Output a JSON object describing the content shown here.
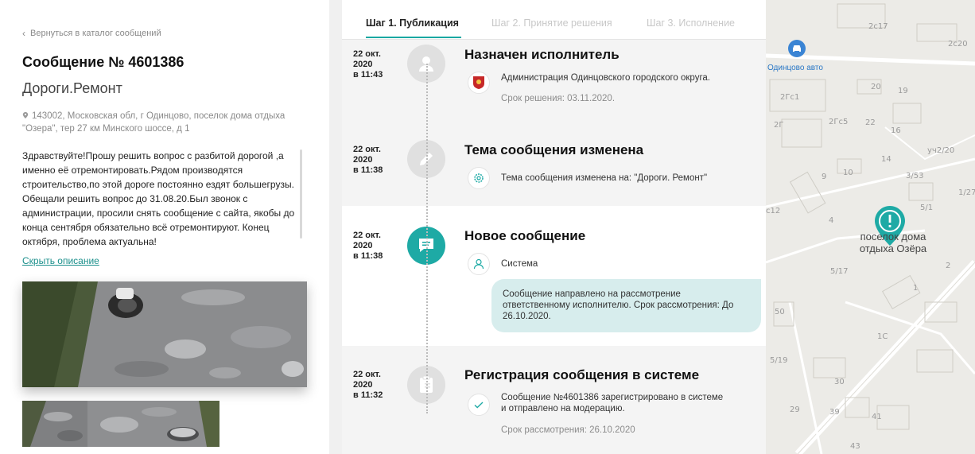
{
  "left": {
    "back_link": "Вернуться в каталог сообщений",
    "title": "Сообщение № 4601386",
    "category": "Дороги.Ремонт",
    "address": "143002, Московская обл, г Одинцово, поселок дома отдыха \"Озера\", тер 27 км Минского шоссе, д 1",
    "description": "Здравствуйте!Прошу решить вопрос с разбитой дорогой ,а именно её отремонтировать.Рядом производятся строительство,по этой дороге постоянно ездят большегрузы. Обещали решить вопрос до 31.08.20.Был звонок с администрации, просили снять сообщение с сайта, якобы до конца сентября обязательно всё отремонтируют. Конец октября, проблема актуальна!",
    "hide_description": "Скрыть описание"
  },
  "tabs": [
    {
      "label": "Шаг 1. Публикация",
      "active": true
    },
    {
      "label": "Шаг 2. Принятие решения",
      "active": false
    },
    {
      "label": "Шаг 3. Исполнение",
      "active": false
    }
  ],
  "events": [
    {
      "date": "22 окт.",
      "year": "2020",
      "time": "в 11:43",
      "title": "Назначен исполнитель",
      "icon": "person-icon",
      "text": "Администрация Одинцовского городского округа.",
      "sub": "Срок решения: 03.11.2020."
    },
    {
      "date": "22 окт.",
      "year": "2020",
      "time": "в 11:38",
      "title": "Тема сообщения изменена",
      "icon": "pencil-icon",
      "text": "Тема сообщения изменена на: \"Дороги. Ремонт\""
    },
    {
      "date": "22 окт.",
      "year": "2020",
      "time": "в 11:38",
      "title": "Новое сообщение",
      "icon": "message-icon",
      "text": "Система",
      "bubble": "Сообщение направлено на рассмотрение ответственному исполнителю. Срок рассмотрения: До 26.10.2020."
    },
    {
      "date": "22 окт.",
      "year": "2020",
      "time": "в 11:32",
      "title": "Регистрация сообщения в системе",
      "icon": "clipboard-icon",
      "text_line1": "Сообщение №4601386 зарегистрировано в системе",
      "text_line2": "и отправлено на модерацию.",
      "sub": "Срок рассмотрения: 26.10.2020"
    }
  ],
  "map": {
    "poi": "Одинцово авто",
    "place_line1": "поселок дома",
    "place_line2": "отдыха Озёра",
    "labels": [
      "2с17",
      "2с20",
      "20",
      "19",
      "2Гс1",
      "2Гс5",
      "22",
      "2Г",
      "16",
      "уч2/20",
      "14",
      "3/53",
      "9",
      "10",
      "1/27",
      "5/1",
      "с12",
      "4",
      "2",
      "5/17",
      "1",
      "50",
      "1С",
      "5/19",
      "30",
      "29",
      "39",
      "41",
      "43"
    ]
  },
  "colors": {
    "accent": "#1eaaa5",
    "link": "#1a8f8b",
    "bubble": "#d7eded"
  }
}
